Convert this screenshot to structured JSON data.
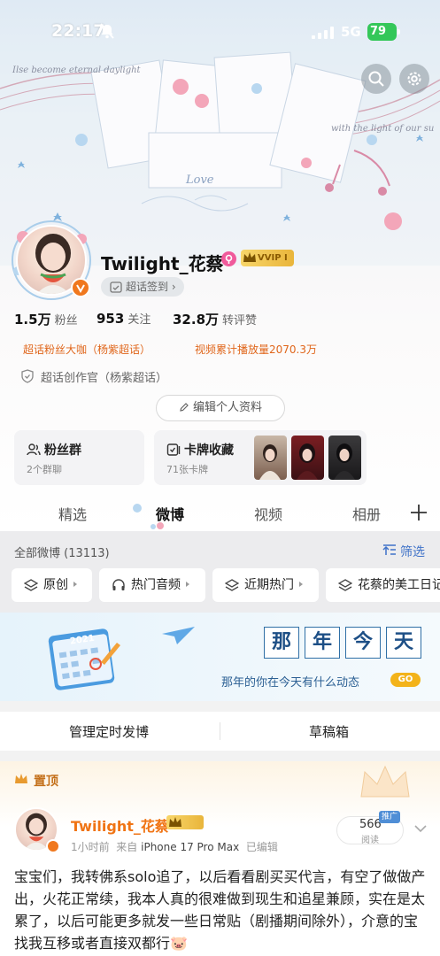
{
  "status_bar": {
    "time": "22:17",
    "network": "5G",
    "battery": "79"
  },
  "profile": {
    "username": "Twilight_花蔡",
    "vip_badge": "VVIP Ⅰ",
    "checkin_label": "超话签到",
    "stats": [
      {
        "value": "1.5万",
        "label": "粉丝"
      },
      {
        "value": "953",
        "label": "关注"
      },
      {
        "value": "32.8万",
        "label": "转评赞"
      }
    ],
    "honors": [
      "超话粉丝大咖（杨紫超话）",
      "视频累计播放量2070.3万"
    ],
    "creator_title": "超话创作官（杨紫超话）",
    "edit_label": "编辑个人资料",
    "cards": [
      {
        "title": "粉丝群",
        "sub": "2个群聊",
        "icon": "group-icon"
      },
      {
        "title": "卡牌收藏",
        "sub": "71张卡牌",
        "icon": "card-collection-icon"
      }
    ]
  },
  "tabs": [
    "精选",
    "微博",
    "视频",
    "相册"
  ],
  "active_tab": "微博",
  "feed": {
    "all_weibo": "全部微博 (13113)",
    "filter_label": "筛选",
    "chips": [
      "原创",
      "热门音频",
      "近期热门",
      "花蔡的美工日记"
    ]
  },
  "banner": {
    "title_chars": [
      "那",
      "年",
      "今",
      "天"
    ],
    "subtitle": "那年的你在今天有什么动态",
    "go_label": "GO",
    "calendar_year": "2021"
  },
  "manage": {
    "scheduled": "管理定时发博",
    "drafts": "草稿箱"
  },
  "pinned_post": {
    "pinned_label": "置顶",
    "author": "Twilight_花蔡",
    "time": "1小时前",
    "source_prefix": "来自",
    "device": "iPhone 17 Pro Max",
    "edited": "已编辑",
    "read_count": "566",
    "read_label": "阅读",
    "promo_tag": "推广",
    "text": "宝宝们，我转佛系solo追了，以后看看剧买买代言，有空了做做产出，火花正常续，我本人真的很难做到现生和追星兼顾，实在是太累了，以后可能更多就发一些日常贴（剧播期间除外），介意的宝找我互移或者直接双都行🐷"
  },
  "colors": {
    "accent_orange": "#f07414",
    "link_blue": "#3f72c8",
    "honor_orange": "#e0661b",
    "vip_gold": "#e9b53b"
  }
}
